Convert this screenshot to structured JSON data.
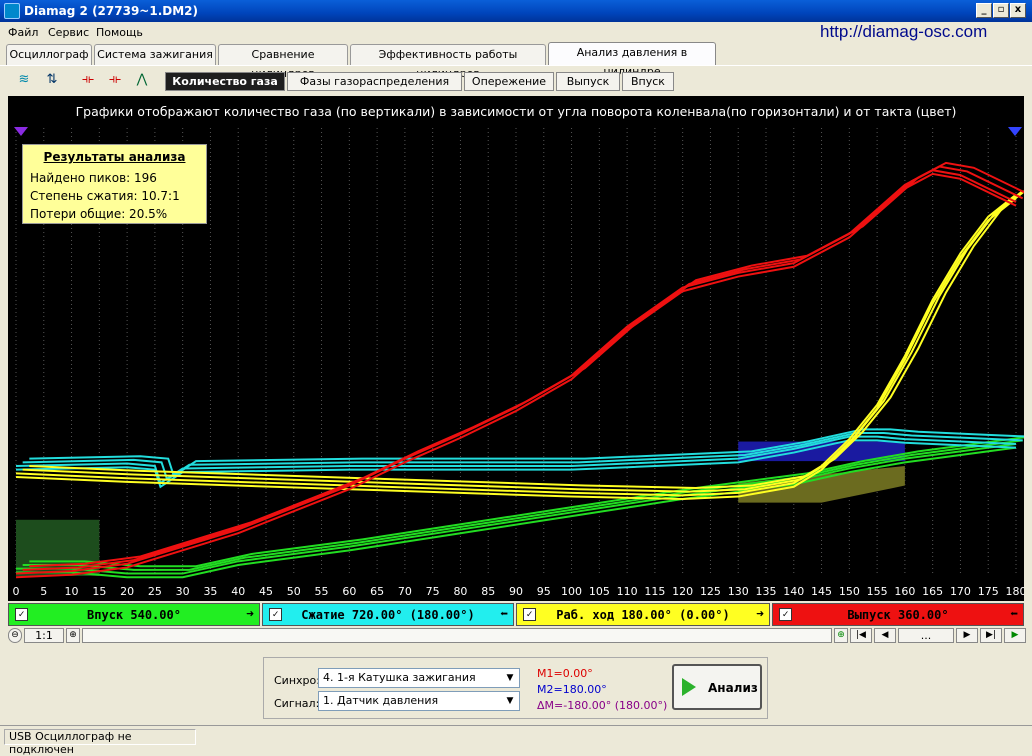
{
  "window": {
    "title": "Diamag 2 (27739~1.DM2)",
    "controls": [
      "_",
      "&",
      "X"
    ]
  },
  "menu": [
    "Файл",
    "Сервис",
    "Помощь"
  ],
  "site_url": "http://diamag-osc.com",
  "tabs": [
    {
      "label": "Осциллограф"
    },
    {
      "label": "Система зажигания"
    },
    {
      "label": "Сравнение цилиндров"
    },
    {
      "label": "Эффективность работы цилиндров"
    },
    {
      "label": "Анализ давления в цилиндре",
      "active": true
    }
  ],
  "subtabs": [
    {
      "label": "Количество газа",
      "active": true
    },
    {
      "label": "Фазы газораспределения"
    },
    {
      "label": "Опережение"
    },
    {
      "label": "Выпуск"
    },
    {
      "label": "Впуск"
    }
  ],
  "plot": {
    "caption": "Графики отображают количество газа (по вертикали) в зависимости от угла поворота коленвала(по горизонтали) и от такта (цвет)",
    "results": {
      "heading": "Результаты анализа",
      "peaks": "Найдено пиков: 196",
      "compression": "Степень сжатия: 10.7:1",
      "losses": "Потери общие: 20.5%"
    }
  },
  "chart_data": {
    "type": "line",
    "xlim": [
      0,
      180
    ],
    "x_ticks": [
      0,
      5,
      10,
      15,
      20,
      25,
      30,
      35,
      40,
      45,
      50,
      55,
      60,
      65,
      70,
      75,
      80,
      85,
      90,
      95,
      100,
      105,
      110,
      115,
      120,
      125,
      130,
      135,
      140,
      145,
      150,
      155,
      160,
      165,
      170,
      175,
      180
    ],
    "grid": true,
    "series": [
      {
        "name": "Впуск 540.00°",
        "color": "#22dd22",
        "x": [
          0,
          10,
          20,
          30,
          40,
          60,
          80,
          100,
          120,
          140,
          150,
          160,
          170,
          180
        ],
        "y": [
          3,
          3,
          1,
          1,
          6,
          12,
          19,
          26,
          33,
          39,
          44,
          48,
          51,
          54
        ]
      },
      {
        "name": "Сжатие 720.00° (180.00°)",
        "color": "#22dddd",
        "x": [
          0,
          20,
          25,
          26,
          30,
          60,
          100,
          130,
          140,
          150,
          155,
          160,
          170,
          180
        ],
        "y": [
          45,
          46,
          45,
          38,
          44,
          45,
          45,
          48,
          52,
          57,
          57,
          56,
          55,
          54
        ]
      },
      {
        "name": "Раб. ход 180.00° (0.00°)",
        "color": "#ffff22",
        "x": [
          0,
          20,
          60,
          100,
          120,
          130,
          140,
          145,
          150,
          155,
          160,
          165,
          170,
          175,
          180
        ],
        "y": [
          42,
          40,
          37,
          34,
          33,
          34,
          38,
          45,
          56,
          70,
          90,
          113,
          132,
          147,
          156
        ]
      },
      {
        "name": "Выпуск 360.00°",
        "color": "#ee1111",
        "x": [
          0,
          10,
          20,
          30,
          40,
          50,
          60,
          70,
          80,
          90,
          100,
          110,
          120,
          130,
          140,
          150,
          160,
          165,
          170,
          180
        ],
        "y": [
          1,
          2,
          5,
          12,
          19,
          28,
          37,
          48,
          58,
          69,
          82,
          102,
          118,
          124,
          128,
          140,
          160,
          166,
          164,
          153
        ]
      }
    ]
  },
  "strips": [
    {
      "label": "Впуск 540.00°",
      "color": "#22ee22",
      "check": "✓",
      "arrow": "➜"
    },
    {
      "label": "Сжатие 720.00° (180.00°)",
      "color": "#22eeee",
      "check": "✓",
      "arrow": "⬅"
    },
    {
      "label": "Раб. ход 180.00° (0.00°)",
      "color": "#ffff22",
      "check": "✓",
      "arrow": "➜"
    },
    {
      "label": "Выпуск 360.00°",
      "color": "#ee1111",
      "check": "✓",
      "arrow": "⬅"
    }
  ],
  "scroll": {
    "zoom_out": "⊖",
    "ratio": "1:1",
    "zoom_in": "⊕",
    "dots": "...",
    "add": "⊕"
  },
  "bottom": {
    "sync_label": "Синхро:",
    "sync_value": "4.  1-я Катушка зажигания",
    "signal_label": "Сигнал:",
    "signal_value": "1.  Датчик давления",
    "m1": "M1=0.00°",
    "m2": "M2=180.00°",
    "dm": "ΔM=-180.00° (180.00°)",
    "analyze_label": "Анализ"
  },
  "status": "USB Осциллограф не подключен"
}
